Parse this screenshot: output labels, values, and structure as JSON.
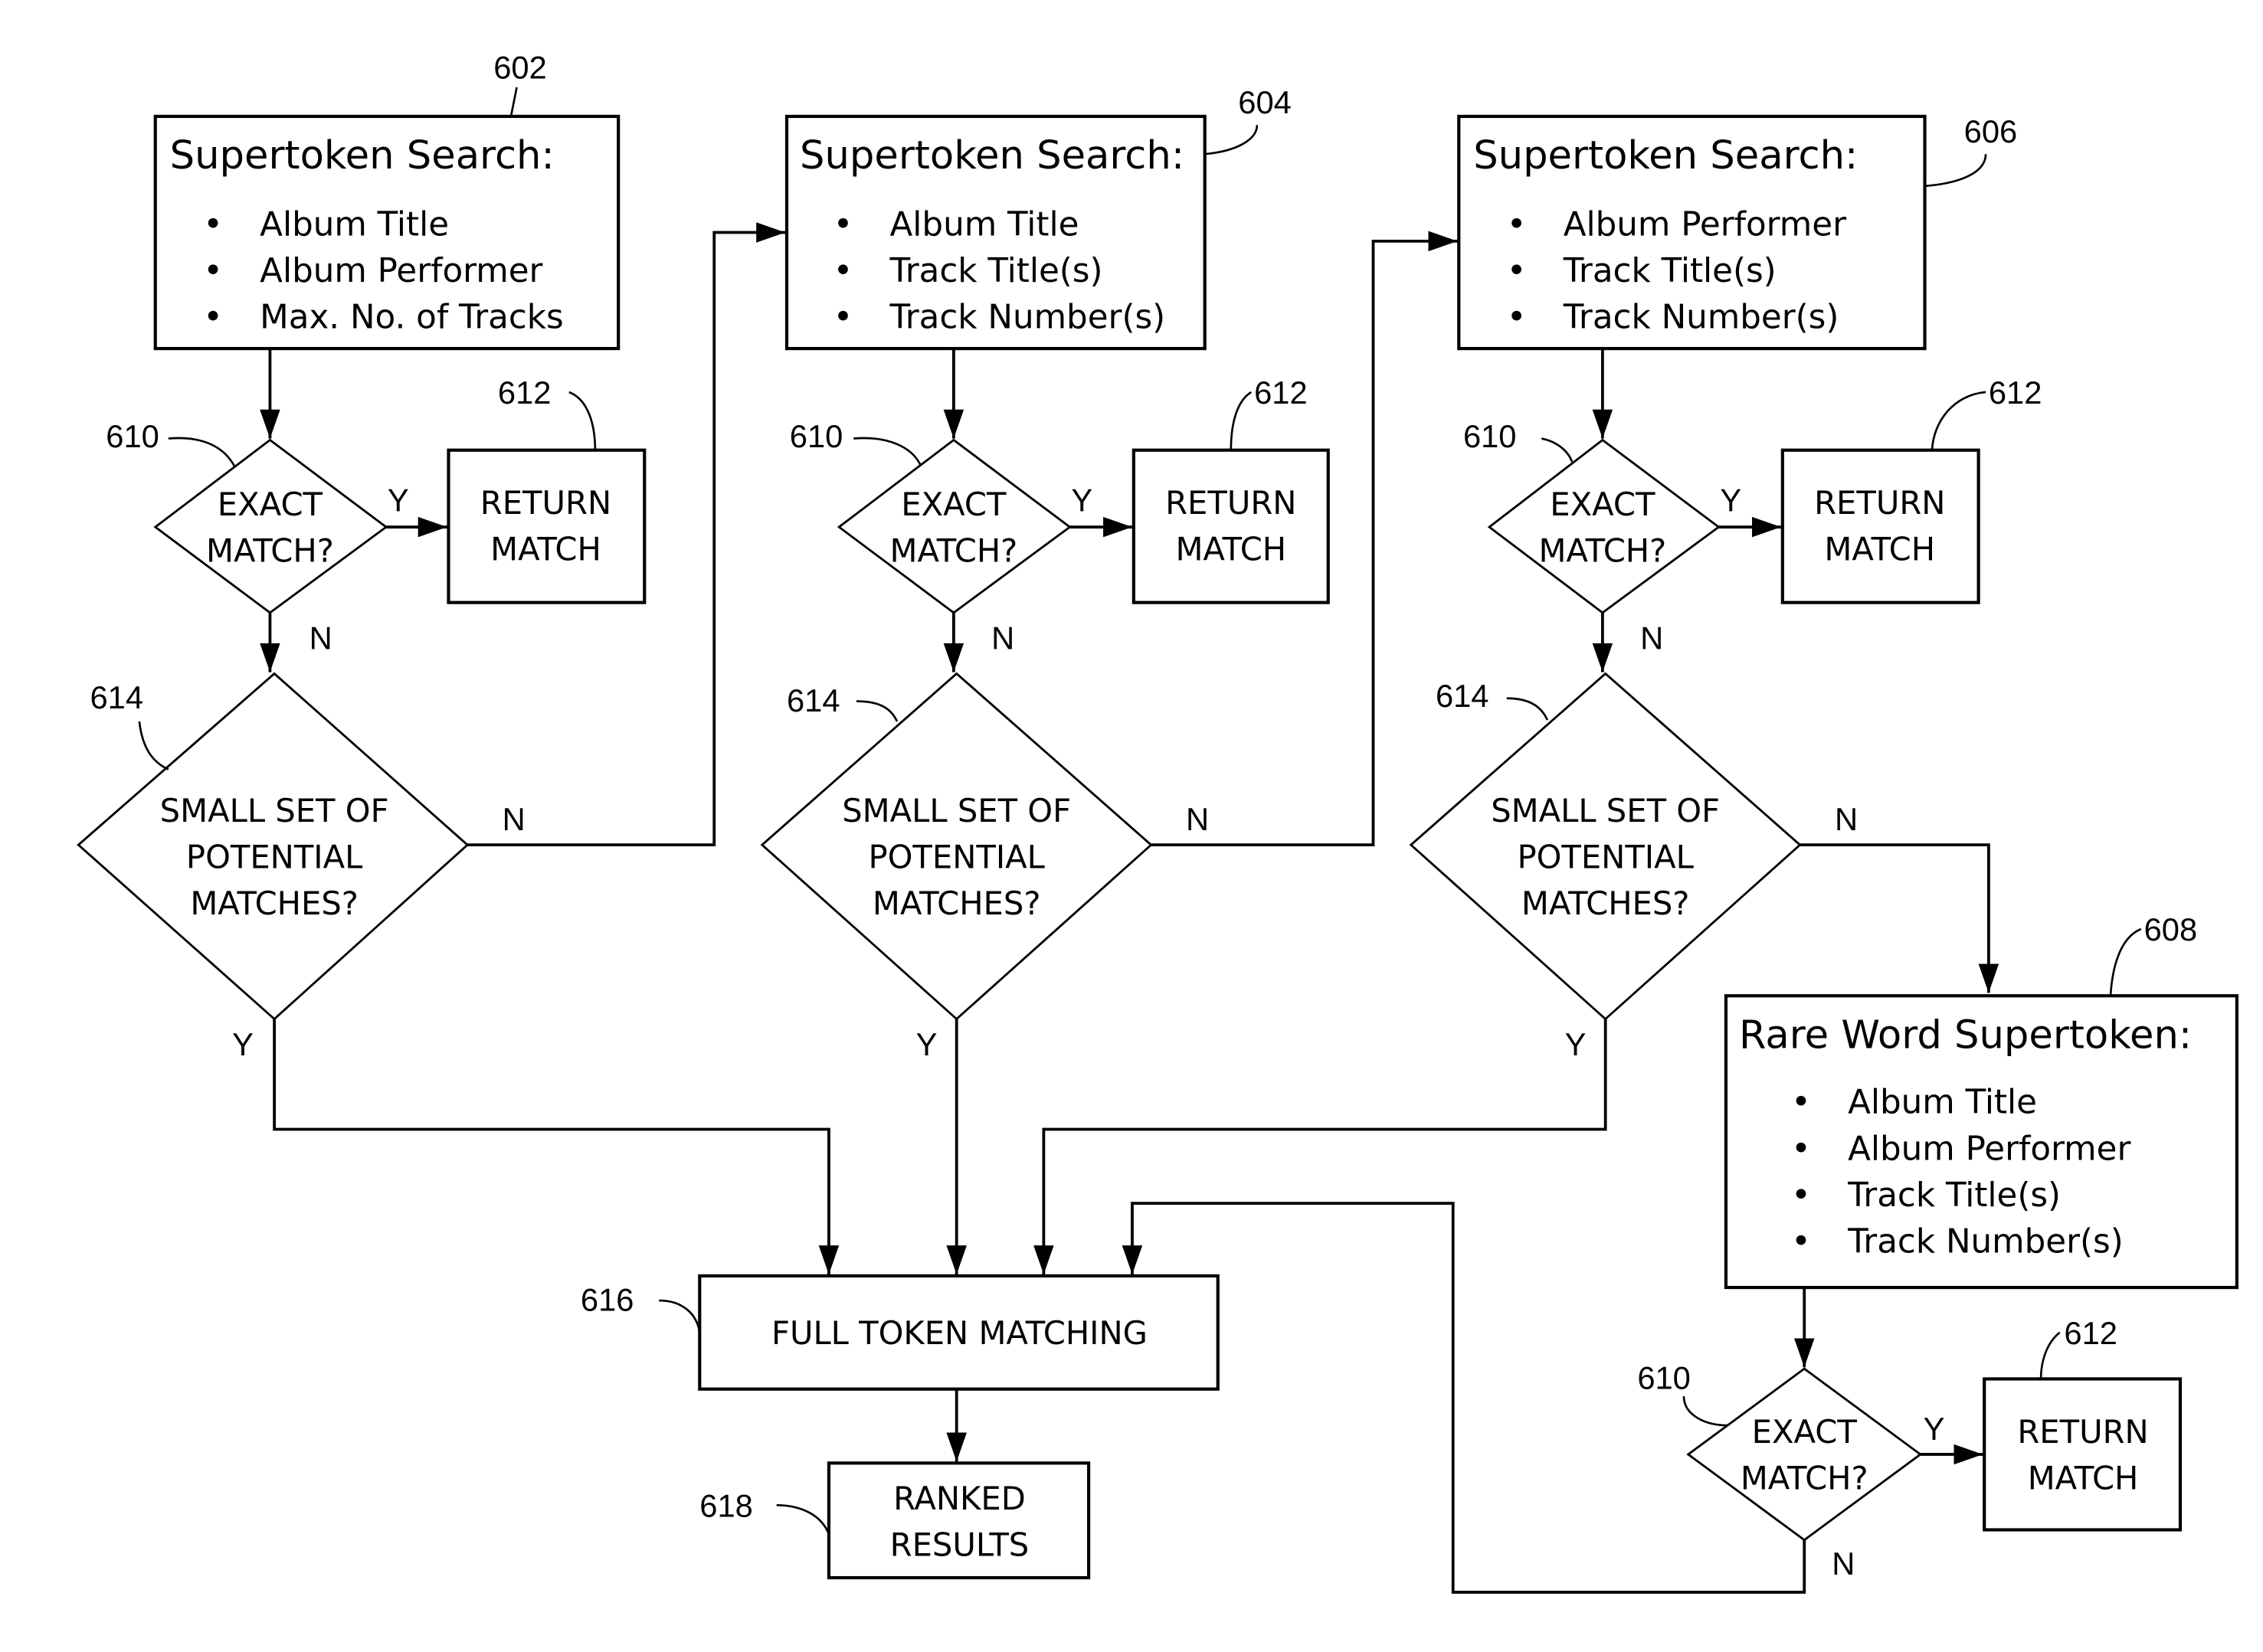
{
  "figure": {
    "search_boxes": [
      {
        "ref": "602",
        "title": "Supertoken Search:",
        "items": [
          "Album Title",
          "Album Performer",
          "Max. No. of Tracks"
        ]
      },
      {
        "ref": "604",
        "title": "Supertoken Search:",
        "items": [
          "Album Title",
          "Track Title(s)",
          "Track Number(s)"
        ]
      },
      {
        "ref": "606",
        "title": "Supertoken Search:",
        "items": [
          "Album Performer",
          "Track Title(s)",
          "Track Number(s)"
        ]
      },
      {
        "ref": "608",
        "title": "Rare Word Supertoken:",
        "items": [
          "Album Title",
          "Album Performer",
          "Track Title(s)",
          "Track Number(s)"
        ]
      }
    ],
    "exact_match": {
      "ref": "610",
      "line1": "EXACT",
      "line2": "MATCH?"
    },
    "return_match": {
      "ref": "612",
      "line1": "RETURN",
      "line2": "MATCH"
    },
    "small_set": {
      "ref": "614",
      "line1": "SMALL SET OF",
      "line2": "POTENTIAL",
      "line3": "MATCHES?"
    },
    "full_token": {
      "ref": "616",
      "label": "FULL TOKEN MATCHING"
    },
    "ranked": {
      "ref": "618",
      "line1": "RANKED",
      "line2": "RESULTS"
    },
    "yes": "Y",
    "no": "N",
    "bullet": "•"
  }
}
